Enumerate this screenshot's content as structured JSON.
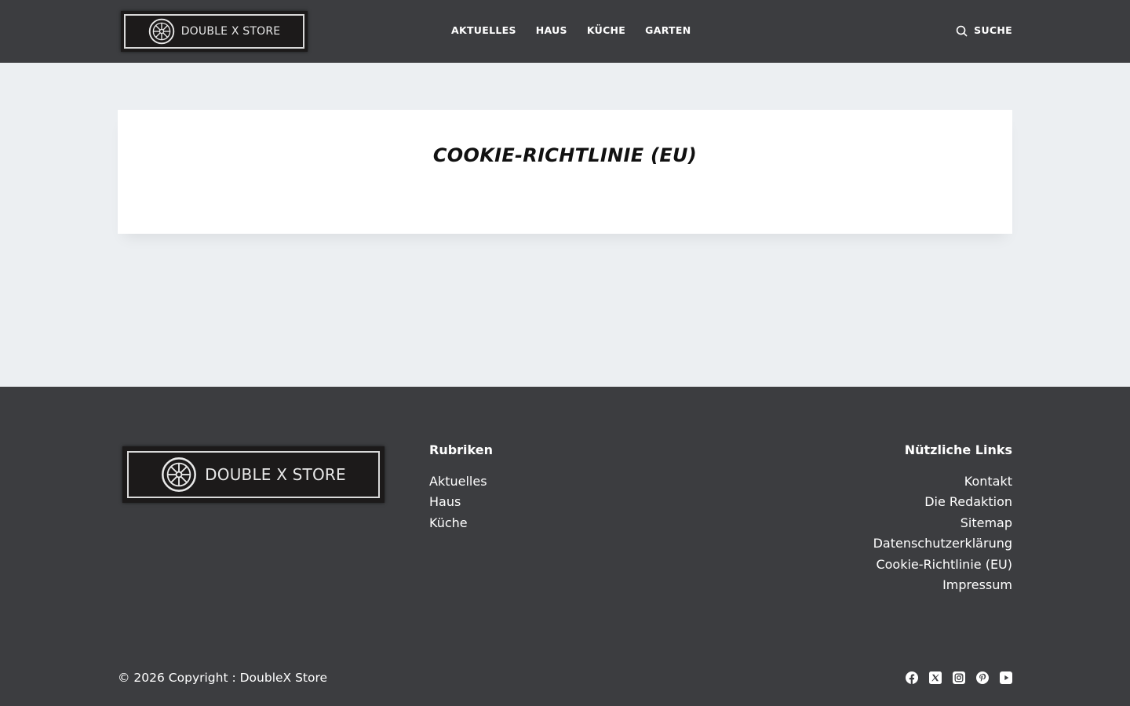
{
  "colors": {
    "header_bg": "#3C3D40",
    "page_bg": "#ECEFF2",
    "card_bg": "#FFFFFF",
    "footer_bg": "#3C3D40",
    "text_light": "#FFFFFF",
    "logo_bg": "#1C1A1A"
  },
  "header": {
    "logo_text": "DOUBLE X STORE",
    "nav": [
      {
        "label": "AKTUELLES"
      },
      {
        "label": "HAUS"
      },
      {
        "label": "KÜCHE"
      },
      {
        "label": "GARTEN"
      }
    ],
    "search_label": "SUCHE",
    "search_icon": "search-icon"
  },
  "main": {
    "title": "COOKIE-RICHTLINIE (EU)"
  },
  "footer": {
    "logo_text": "DOUBLE X STORE",
    "rubriken": {
      "title": "Rubriken",
      "items": [
        "Aktuelles",
        "Haus",
        "Küche"
      ]
    },
    "useful_links": {
      "title": "Nützliche Links",
      "items": [
        "Kontakt",
        "Die Redaktion",
        "Sitemap",
        "Datenschutzerklärung",
        "Cookie-Richtlinie (EU)",
        "Impressum"
      ]
    },
    "copyright": "© 2026 Copyright : DoubleX Store",
    "social_icons": [
      "facebook-icon",
      "x-icon",
      "instagram-icon",
      "pinterest-icon",
      "youtube-icon"
    ]
  }
}
